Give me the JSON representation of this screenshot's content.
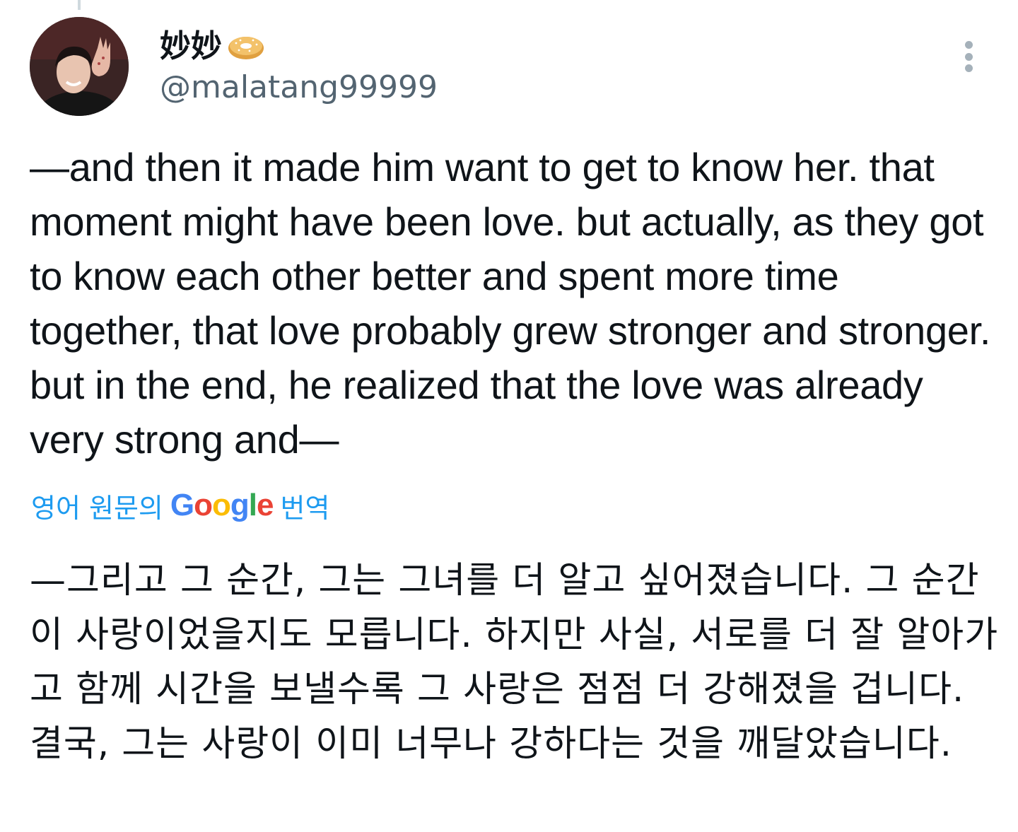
{
  "author": {
    "display_name": "妙妙",
    "display_name_emoji": "bagel-icon",
    "handle": "@malatang99999"
  },
  "tweet": {
    "text": "—and then it made him want to get to know her. that moment might have been love. but actually, as they got to know each other better and spent more time together, that love probably grew stronger and stronger. but in the end, he realized that the love was already very strong and—"
  },
  "translation": {
    "prefix": "영어 원문의",
    "logo": [
      "G",
      "o",
      "o",
      "g",
      "l",
      "e"
    ],
    "suffix": "번역",
    "text": "—그리고 그 순간, 그는 그녀를 더 알고 싶어졌습니다. 그 순간이 사랑이었을지도 모릅니다. 하지만 사실, 서로를 더 잘 알아가고 함께 시간을 보낼수록 그 사랑은 점점 더 강해졌을 겁니다. 결국, 그는 사랑이 이미 너무나 강하다는 것을 깨달았습니다."
  },
  "colors": {
    "text": "#0f1419",
    "secondary": "#536471",
    "link": "#1d9bf0",
    "google_blue": "#4285f4",
    "google_red": "#ea4335",
    "google_yellow": "#fbbc05",
    "google_green": "#34a853"
  },
  "icons": {
    "more": "more-vertical-icon",
    "avatar": "avatar"
  }
}
